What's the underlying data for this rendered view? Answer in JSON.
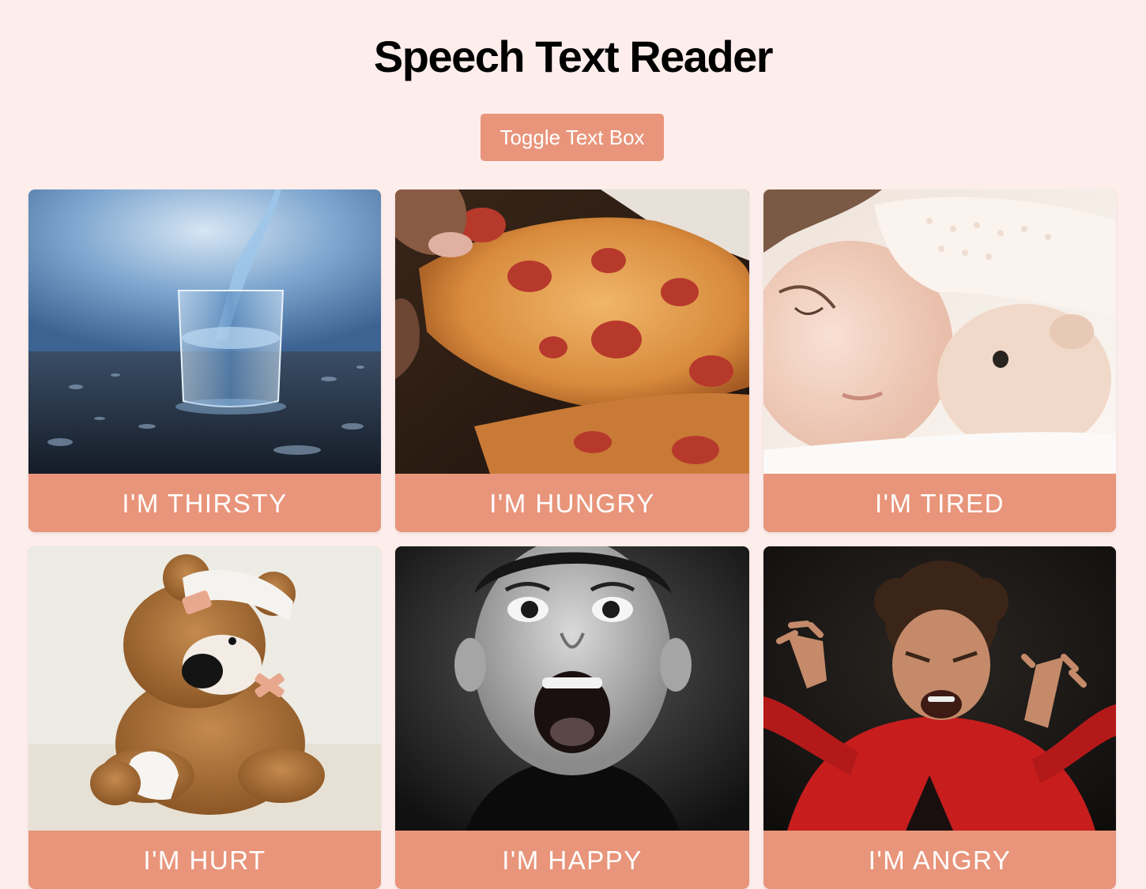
{
  "header": {
    "title": "Speech Text Reader"
  },
  "toolbar": {
    "toggle_label": "Toggle Text Box"
  },
  "cards": [
    {
      "label": "I'M THIRSTY"
    },
    {
      "label": "I'M HUNGRY"
    },
    {
      "label": "I'M TIRED"
    },
    {
      "label": "I'M HURT"
    },
    {
      "label": "I'M HAPPY"
    },
    {
      "label": "I'M ANGRY"
    }
  ],
  "colors": {
    "background": "#fdeeec",
    "accent": "#e8957b",
    "button_text": "#ffffff"
  },
  "images": {
    "card_0": "glass-of-water-photo",
    "card_1": "pizza-slice-photo",
    "card_2": "sleeping-child-photo",
    "card_3": "bandaged-teddy-bear-photo",
    "card_4": "excited-boy-photo",
    "card_5": "angry-child-photo"
  }
}
